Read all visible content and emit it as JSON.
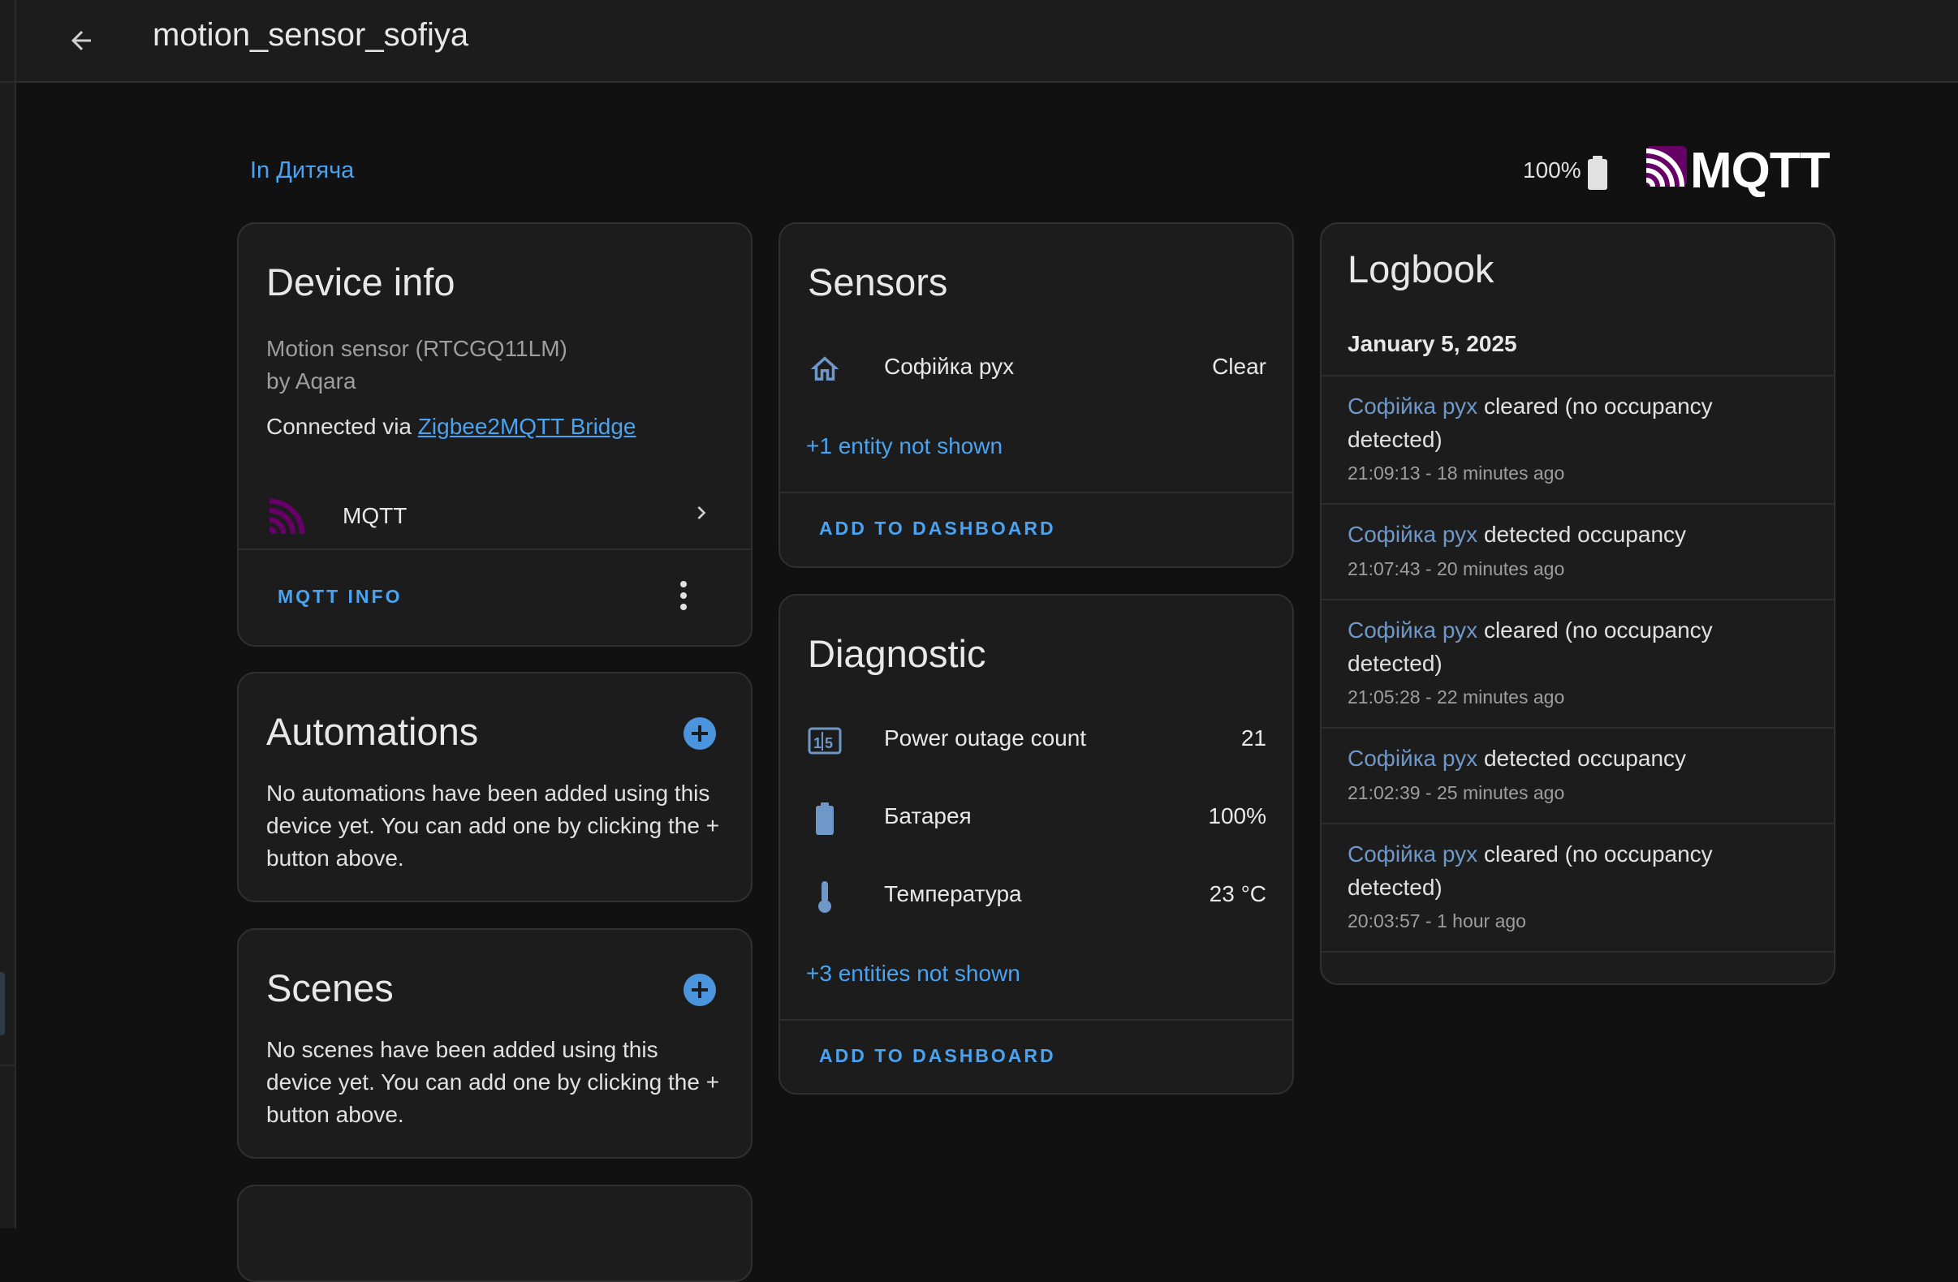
{
  "header": {
    "title": "motion_sensor_sofiya"
  },
  "area": {
    "label": "In Дитяча"
  },
  "battery": {
    "label": "100%"
  },
  "integration_logo": {
    "text": "MQTT"
  },
  "device_info": {
    "title": "Device info",
    "model": "Motion sensor (RTCGQ11LM)",
    "manufacturer": "by Aqara",
    "connected_prefix": "Connected via ",
    "connected_link": "Zigbee2MQTT Bridge",
    "integration_name": "MQTT",
    "action_label": "MQTT INFO"
  },
  "automations": {
    "title": "Automations",
    "empty_text": "No automations have been added using this device yet. You can add one by clicking the + button above."
  },
  "scenes": {
    "title": "Scenes",
    "empty_text": "No scenes have been added using this device yet. You can add one by clicking the + button above."
  },
  "sensors": {
    "title": "Sensors",
    "entities": [
      {
        "icon": "home-icon",
        "name": "Софійка рух",
        "value": "Clear"
      }
    ],
    "more_label": "+1 entity not shown",
    "add_label": "ADD TO DASHBOARD"
  },
  "diagnostic": {
    "title": "Diagnostic",
    "entities": [
      {
        "icon": "counter-icon",
        "name": "Power outage count",
        "value": "21"
      },
      {
        "icon": "battery-icon",
        "name": "Батарея",
        "value": "100%"
      },
      {
        "icon": "thermometer-icon",
        "name": "Температура",
        "value": "23 °C"
      }
    ],
    "more_label": "+3 entities not shown",
    "add_label": "ADD TO DASHBOARD"
  },
  "logbook": {
    "title": "Logbook",
    "date": "January 5, 2025",
    "entries": [
      {
        "entity": "Софійка рух",
        "message": " cleared (no occupancy detected)",
        "time": "21:09:13 - 18 minutes ago"
      },
      {
        "entity": "Софійка рух",
        "message": " detected occupancy",
        "time": "21:07:43 - 20 minutes ago"
      },
      {
        "entity": "Софійка рух",
        "message": " cleared (no occupancy detected)",
        "time": "21:05:28 - 22 minutes ago"
      },
      {
        "entity": "Софійка рух",
        "message": " detected occupancy",
        "time": "21:02:39 - 25 minutes ago"
      },
      {
        "entity": "Софійка рух",
        "message": " cleared (no occupancy detected)",
        "time": "20:03:57 - 1 hour ago"
      }
    ]
  },
  "colors": {
    "accent": "#4aa3f0",
    "mqtt_purple": "#660066",
    "card_bg": "#1c1c1c",
    "page_bg": "#111111"
  }
}
